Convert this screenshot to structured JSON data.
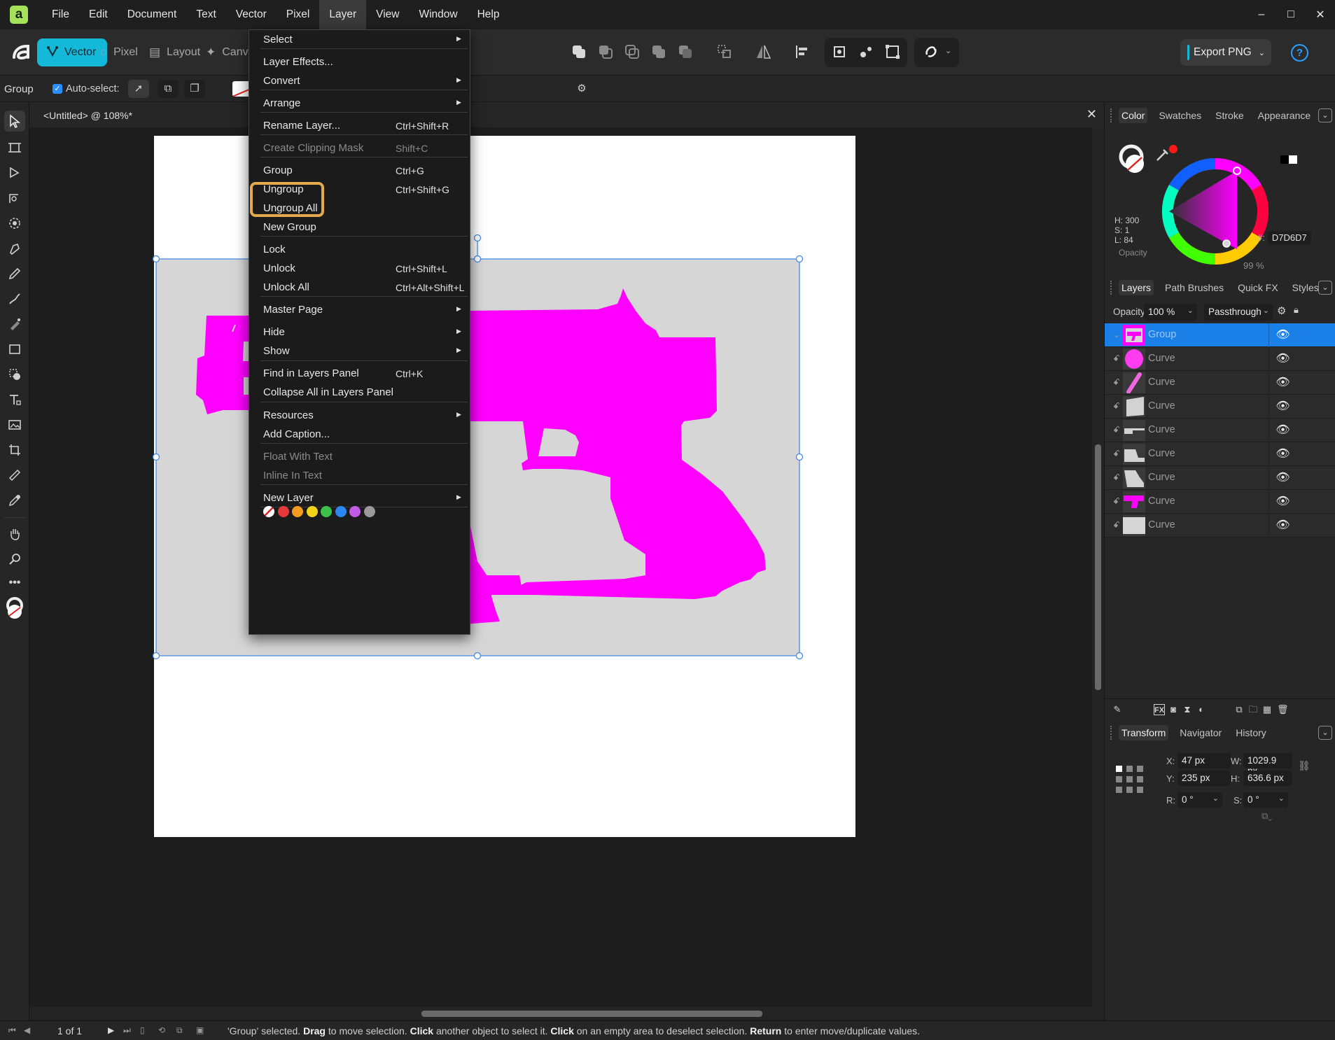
{
  "app": {
    "logo_letter": "a"
  },
  "menubar": {
    "items": [
      "File",
      "Edit",
      "Document",
      "Text",
      "Vector",
      "Pixel",
      "Layer",
      "View",
      "Window",
      "Help"
    ],
    "active": "Layer"
  },
  "window_controls": {
    "minimize": "–",
    "maximize": "□",
    "close": "✕"
  },
  "toolbar": {
    "personas": [
      "Vector",
      "Pixel",
      "Layout",
      "Canva"
    ],
    "active_persona": "Vector",
    "export_label": "Export PNG",
    "help_label": "?"
  },
  "context_toolbar": {
    "mode_label": "Group",
    "autoselect_label": "Auto-select:",
    "autoselect_checked": true
  },
  "document": {
    "title": "<Untitled> @ 108%*"
  },
  "layer_menu": {
    "items": [
      {
        "label": "Select",
        "shortcut": "",
        "submenu": true,
        "disabled": false
      },
      {
        "label": "Layer Effects...",
        "shortcut": "",
        "submenu": false,
        "disabled": false
      },
      {
        "label": "Convert",
        "shortcut": "",
        "submenu": true,
        "disabled": false
      },
      {
        "label": "Arrange",
        "shortcut": "",
        "submenu": true,
        "disabled": false
      },
      {
        "label": "Rename Layer...",
        "shortcut": "Ctrl+Shift+R",
        "submenu": false,
        "disabled": false
      },
      {
        "label": "Create Clipping Mask",
        "shortcut": "Shift+C",
        "submenu": false,
        "disabled": true
      },
      {
        "label": "Group",
        "shortcut": "Ctrl+G",
        "submenu": false,
        "disabled": false
      },
      {
        "label": "Ungroup",
        "shortcut": "Ctrl+Shift+G",
        "submenu": false,
        "disabled": false
      },
      {
        "label": "Ungroup All",
        "shortcut": "",
        "submenu": false,
        "disabled": false,
        "highlighted": true
      },
      {
        "label": "New Group",
        "shortcut": "",
        "submenu": false,
        "disabled": false
      },
      {
        "label": "Lock",
        "shortcut": "",
        "submenu": false,
        "disabled": false
      },
      {
        "label": "Unlock",
        "shortcut": "Ctrl+Shift+L",
        "submenu": false,
        "disabled": false
      },
      {
        "label": "Unlock All",
        "shortcut": "Ctrl+Alt+Shift+L",
        "submenu": false,
        "disabled": false
      },
      {
        "label": "Master Page",
        "shortcut": "",
        "submenu": true,
        "disabled": false
      },
      {
        "label": "Hide",
        "shortcut": "",
        "submenu": true,
        "disabled": false
      },
      {
        "label": "Show",
        "shortcut": "",
        "submenu": true,
        "disabled": false
      },
      {
        "label": "Find in Layers Panel",
        "shortcut": "Ctrl+K",
        "submenu": false,
        "disabled": false
      },
      {
        "label": "Collapse All in Layers Panel",
        "shortcut": "",
        "submenu": false,
        "disabled": false
      },
      {
        "label": "Resources",
        "shortcut": "",
        "submenu": true,
        "disabled": false
      },
      {
        "label": "Add Caption...",
        "shortcut": "",
        "submenu": false,
        "disabled": false
      },
      {
        "label": "Float With Text",
        "shortcut": "",
        "submenu": false,
        "disabled": true
      },
      {
        "label": "Inline In Text",
        "shortcut": "",
        "submenu": false,
        "disabled": true
      },
      {
        "label": "New Layer",
        "shortcut": "",
        "submenu": true,
        "disabled": false
      }
    ],
    "color_tags": [
      "none",
      "#e43a3a",
      "#f39c1f",
      "#f2d21a",
      "#3cc24a",
      "#2a86f0",
      "#c25ae6",
      "#9a9a9a"
    ]
  },
  "color_panel": {
    "tabs": [
      "Color",
      "Swatches",
      "Stroke",
      "Appearance"
    ],
    "active_tab": "Color",
    "h_label": "H: 300",
    "s_label": "S: 1",
    "l_label": "L: 84",
    "hex_label": "#:",
    "hex_value": "D7D6D7",
    "opacity_label": "Opacity",
    "opacity_value": "99 %"
  },
  "layers_panel": {
    "tabs": [
      "Layers",
      "Path Brushes",
      "Quick FX",
      "Styles"
    ],
    "active_tab": "Layers",
    "opacity_label": "Opacity:",
    "opacity_value": "100 %",
    "blend_mode": "Passthrough",
    "layers": [
      {
        "name": "Group",
        "selected": true,
        "thumb": "group"
      },
      {
        "name": "Curve",
        "selected": false,
        "thumb": "circle"
      },
      {
        "name": "Curve",
        "selected": false,
        "thumb": "stroke"
      },
      {
        "name": "Curve",
        "selected": false,
        "thumb": "slide"
      },
      {
        "name": "Curve",
        "selected": false,
        "thumb": "barrel"
      },
      {
        "name": "Curve",
        "selected": false,
        "thumb": "frame"
      },
      {
        "name": "Curve",
        "selected": false,
        "thumb": "grip"
      },
      {
        "name": "Curve",
        "selected": false,
        "thumb": "gun"
      },
      {
        "name": "Curve",
        "selected": false,
        "thumb": "rect"
      }
    ]
  },
  "transform_panel": {
    "tabs": [
      "Transform",
      "Navigator",
      "History"
    ],
    "active_tab": "Transform",
    "x_label": "X:",
    "x_value": "47 px",
    "y_label": "Y:",
    "y_value": "235 px",
    "w_label": "W:",
    "w_value": "1029.9 px",
    "h_label": "H:",
    "h_value": "636.6 px",
    "r_label": "R:",
    "r_value": "0 °",
    "s_label": "S:",
    "s_value": "0 °"
  },
  "statusbar": {
    "page": "1 of 1",
    "message_parts": [
      {
        "text": "'Group' selected. ",
        "bold": false
      },
      {
        "text": "Drag",
        "bold": true
      },
      {
        "text": " to move selection. ",
        "bold": false
      },
      {
        "text": "Click",
        "bold": true
      },
      {
        "text": " another object to select it. ",
        "bold": false
      },
      {
        "text": "Click",
        "bold": true
      },
      {
        "text": " on an empty area to deselect selection. ",
        "bold": false
      },
      {
        "text": "Return",
        "bold": true
      },
      {
        "text": " to enter move/duplicate values.",
        "bold": false
      }
    ]
  },
  "colors": {
    "accent": "#14b8d8",
    "selection": "#1a80e8",
    "artwork": "#ff00ff",
    "background_rect": "#d7d6d7",
    "highlight": "#e3a94b"
  }
}
